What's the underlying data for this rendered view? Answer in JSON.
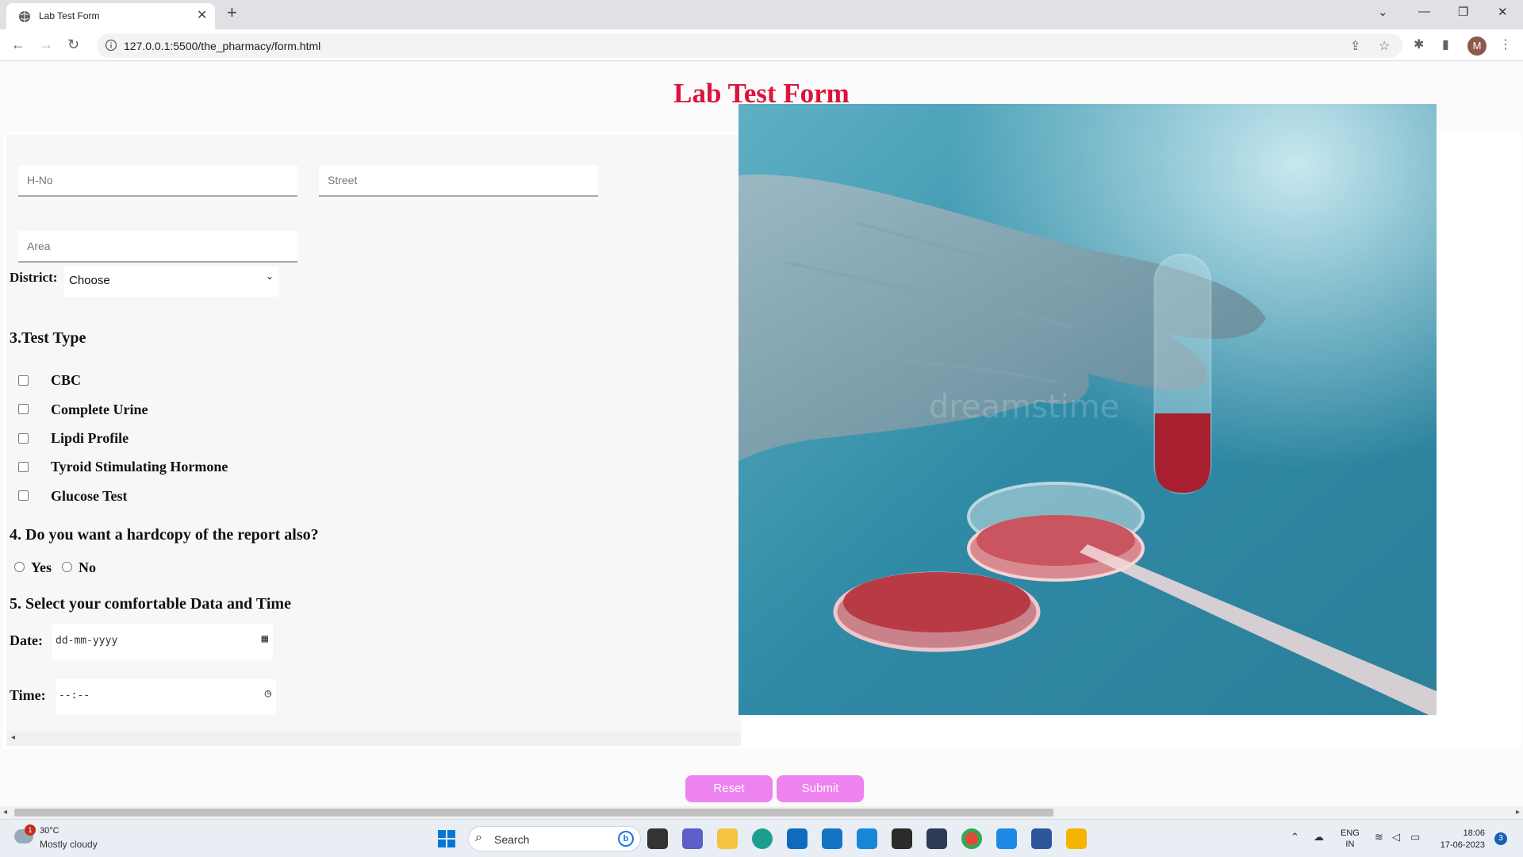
{
  "browser": {
    "tab_title": "Lab Test Form",
    "url": "127.0.0.1:5500/the_pharmacy/form.html",
    "avatar_letter": "M"
  },
  "page": {
    "title": "Lab Test Form",
    "fields": {
      "hno_placeholder": "H-No",
      "street_placeholder": "Street",
      "area_placeholder": "Area"
    },
    "district": {
      "label": "District:",
      "selected": "Choose"
    },
    "test_type": {
      "heading": "3.Test Type",
      "options": [
        "CBC",
        "Complete Urine",
        "Lipdi Profile",
        "Tyroid Stimulating Hormone",
        "Glucose Test"
      ]
    },
    "hardcopy": {
      "heading": "4. Do you want a hardcopy of the report also?",
      "yes": "Yes",
      "no": "No"
    },
    "schedule": {
      "heading": "5. Select your comfortable Data and Time",
      "date_label": "Date:",
      "date_value": "dd-mm-yyyy",
      "time_label": "Time:",
      "time_value": "--:--"
    },
    "image_watermark": "dreamstime",
    "buttons": {
      "reset": "Reset",
      "submit": "Submit"
    },
    "button_color": "#ee82ee",
    "title_color": "#dc143c"
  },
  "taskbar": {
    "weather_temp": "30°C",
    "weather_desc": "Mostly cloudy",
    "weather_badge": "1",
    "search_label": "Search",
    "lang_line1": "ENG",
    "lang_line2": "IN",
    "time": "18:06",
    "date": "17-06-2023",
    "notifications": "3"
  }
}
